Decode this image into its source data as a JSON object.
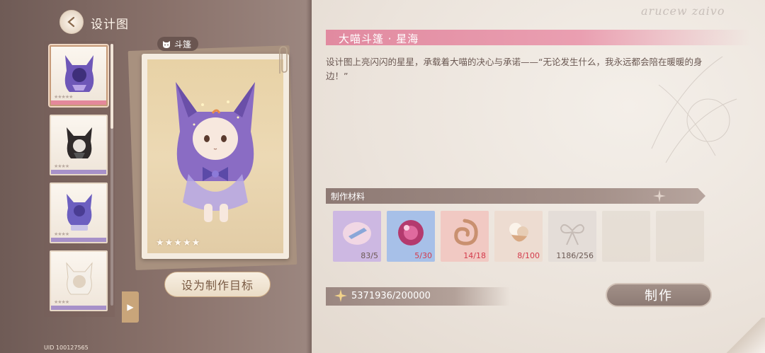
{
  "header": {
    "title": "设计图"
  },
  "watermark": "arucew zaivo",
  "sidebar": {
    "thumbnails": [
      {
        "name": "purple-cat-cloak",
        "stars": "★★★★★",
        "bar_color": "#e4889b",
        "selected": true
      },
      {
        "name": "black-cat-cloak",
        "stars": "★★★★",
        "bar_color": "#a791c9",
        "selected": false
      },
      {
        "name": "violet-cat-cloak",
        "stars": "★★★★",
        "bar_color": "#a791c9",
        "selected": false
      },
      {
        "name": "white-cat-cloak",
        "stars": "★★★★",
        "bar_color": "#a791c9",
        "selected": false
      }
    ],
    "uid": "UID 100127565"
  },
  "card": {
    "category": "斗篷",
    "stars": "★★★★★",
    "set_target_label": "设为制作目标"
  },
  "item": {
    "title": "大喵斗篷 · 星海",
    "description": "设计图上亮闪闪的星星，承载着大喵的决心与承诺——“无论发生什么，我永远都会陪在暖暖的身边！”"
  },
  "materials": {
    "title": "制作材料",
    "items": [
      {
        "icon": "feather-crystal-icon",
        "count": "83/5",
        "status": "ok",
        "bg": "#cdb8e2"
      },
      {
        "icon": "purple-gem-icon",
        "count": "5/30",
        "status": "lack",
        "bg": "#a7c0e8"
      },
      {
        "icon": "swirl-shell-icon",
        "count": "14/18",
        "status": "lack",
        "bg": "#f1c9c3"
      },
      {
        "icon": "pearl-cluster-icon",
        "count": "8/100",
        "status": "lack",
        "bg": "#eddcd1"
      },
      {
        "icon": "ribbon-bow-icon",
        "count": "1186/256",
        "status": "ok",
        "bg": "#e4ddd8"
      }
    ]
  },
  "currency": {
    "value": "5371936/200000"
  },
  "make_label": "制作"
}
